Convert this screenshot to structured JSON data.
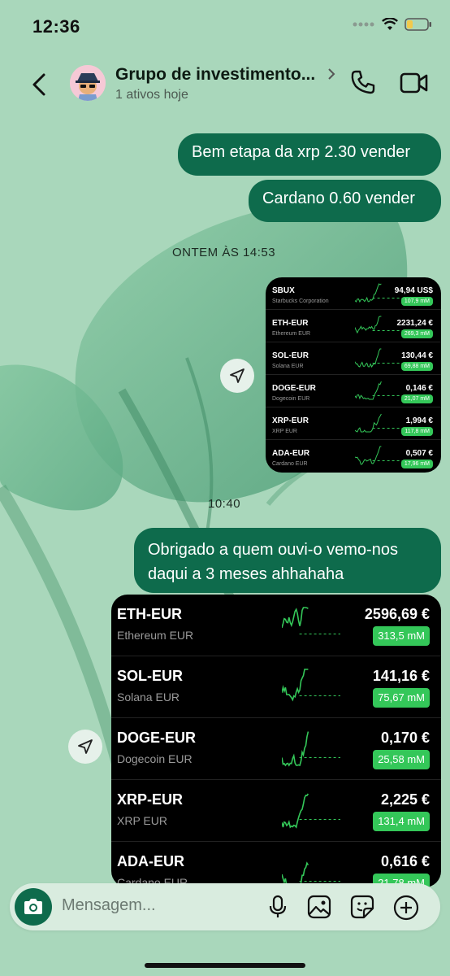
{
  "status": {
    "time": "12:36"
  },
  "header": {
    "title": "Grupo de investimento...",
    "subtitle": "1 ativos hoje"
  },
  "messages": {
    "m1": "Bem etapa da xrp 2.30 vender",
    "m2": "Cardano 0.60 vender",
    "stamp1": "ONTEM ÀS 14:53",
    "stamp2": "10:40",
    "m3_line1": "Obrigado a quem ouvi-o vemo-nos",
    "m3_line2": "daqui a 3 meses ahhahaha"
  },
  "card_small": [
    {
      "symbol": "SBUX",
      "name": "Starbucks Corporation",
      "price": "94,94 US$",
      "badge": "107,9 mM"
    },
    {
      "symbol": "ETH-EUR",
      "name": "Ethereum EUR",
      "price": "2231,24 €",
      "badge": "269,3 mM"
    },
    {
      "symbol": "SOL-EUR",
      "name": "Solana EUR",
      "price": "130,44 €",
      "badge": "69,88 mM"
    },
    {
      "symbol": "DOGE-EUR",
      "name": "Dogecoin EUR",
      "price": "0,146 €",
      "badge": "21,07 mM"
    },
    {
      "symbol": "XRP-EUR",
      "name": "XRP EUR",
      "price": "1,994 €",
      "badge": "117,8 mM"
    },
    {
      "symbol": "ADA-EUR",
      "name": "Cardano EUR",
      "price": "0,507 €",
      "badge": "17,96 mM"
    }
  ],
  "card_large": [
    {
      "symbol": "ETH-EUR",
      "name": "Ethereum EUR",
      "price": "2596,69 €",
      "badge": "313,5 mM"
    },
    {
      "symbol": "SOL-EUR",
      "name": "Solana EUR",
      "price": "141,16 €",
      "badge": "75,67 mM"
    },
    {
      "symbol": "DOGE-EUR",
      "name": "Dogecoin EUR",
      "price": "0,170 €",
      "badge": "25,58 mM"
    },
    {
      "symbol": "XRP-EUR",
      "name": "XRP EUR",
      "price": "2,225 €",
      "badge": "131,4 mM"
    },
    {
      "symbol": "ADA-EUR",
      "name": "Cardano EUR",
      "price": "0,616 €",
      "badge": "21,78 mM"
    }
  ],
  "composer": {
    "placeholder": "Mensagem..."
  },
  "icons": [
    "back-icon",
    "phone-icon",
    "video-icon",
    "share-icon",
    "camera-icon",
    "microphone-icon",
    "gallery-icon",
    "sticker-icon",
    "add-icon"
  ],
  "colors": {
    "accent": "#0e6b4c",
    "positive": "#34c759",
    "background": "#a9d7bb"
  }
}
